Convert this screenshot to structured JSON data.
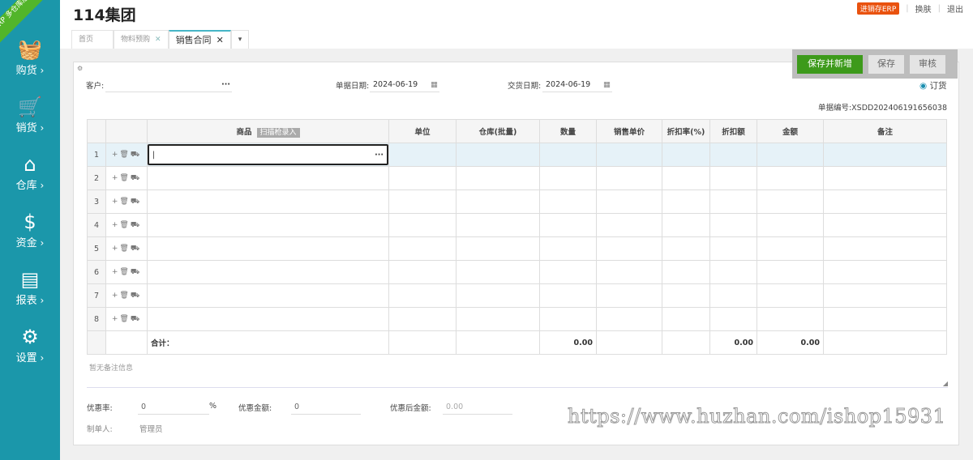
{
  "sidebar": {
    "badge": "ERP 多仓库版",
    "items": [
      {
        "label": "购货",
        "icon": "basket-icon"
      },
      {
        "label": "销货",
        "icon": "cart-icon"
      },
      {
        "label": "仓库",
        "icon": "warehouse-icon"
      },
      {
        "label": "资金",
        "icon": "dollar-icon"
      },
      {
        "label": "报表",
        "icon": "report-icon"
      },
      {
        "label": "设置",
        "icon": "gear-icon"
      }
    ]
  },
  "header": {
    "title": "114集团",
    "erp": "进销存ERP",
    "skin": "换肤",
    "logout": "退出"
  },
  "tabs": [
    {
      "label": "首页"
    },
    {
      "label": "物料预购"
    },
    {
      "label": "销售合同"
    }
  ],
  "toolbar": {
    "save_new": "保存并新增",
    "save": "保存",
    "audit": "审核"
  },
  "form": {
    "customer_label": "客户:",
    "customer_value": "",
    "date_label": "单据日期:",
    "date_value": "2024-06-19",
    "delivery_label": "交货日期:",
    "delivery_value": "2024-06-19",
    "order_radio": "订货",
    "bill_no": "单据编号:XSDD202406191656038"
  },
  "table": {
    "headers": [
      "商品",
      "单位",
      "仓库(批量)",
      "数量",
      "销售单价",
      "折扣率(%)",
      "折扣额",
      "金额",
      "备注"
    ],
    "scan_label": "扫描枪录入",
    "rows": [
      "1",
      "2",
      "3",
      "4",
      "5",
      "6",
      "7",
      "8"
    ],
    "total_label": "合计：",
    "total_qty": "0.00",
    "total_discount": "0.00",
    "total_amount": "0.00"
  },
  "remark": {
    "placeholder": "暂无备注信息"
  },
  "footer": {
    "rate_label": "优惠率:",
    "rate_value": "0",
    "rate_unit": "%",
    "amount_label": "优惠金额:",
    "amount_value": "0",
    "after_label": "优惠后金额:",
    "after_value": "0.00",
    "maker_label": "制单人:",
    "maker_value": "管理员"
  },
  "watermark": "https://www.huzhan.com/ishop15931"
}
